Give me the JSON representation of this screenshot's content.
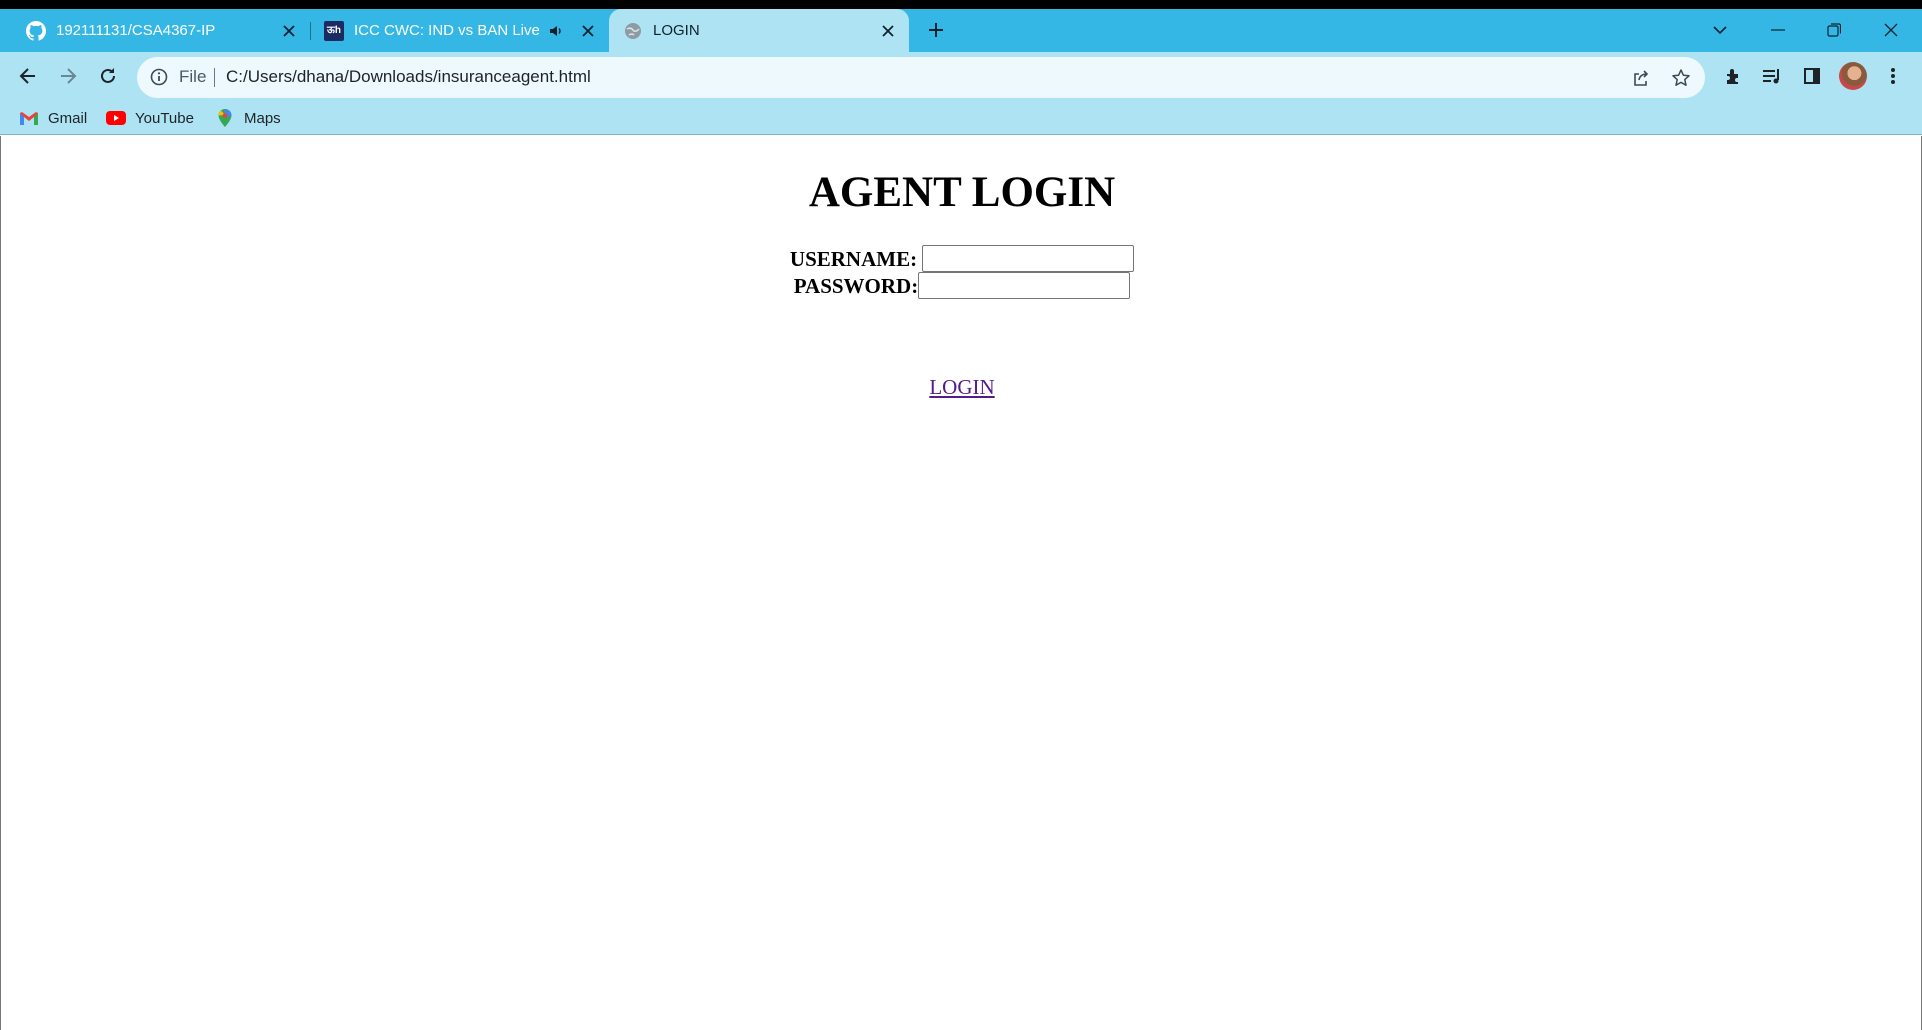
{
  "browser": {
    "tabs": [
      {
        "title": "192111131/CSA4367-IP",
        "icon": "github-icon",
        "active": false
      },
      {
        "title": "ICC CWC: IND vs BAN Live s",
        "icon": "dh-news-icon",
        "audio": true,
        "active": false
      },
      {
        "title": "LOGIN",
        "icon": "globe-icon",
        "active": true
      }
    ],
    "new_tab_label": "+",
    "address": {
      "scheme_label": "File",
      "url": "C:/Users/dhana/Downloads/insuranceagent.html"
    },
    "bookmarks": [
      {
        "label": "Gmail",
        "icon": "gmail-icon"
      },
      {
        "label": "YouTube",
        "icon": "youtube-icon"
      },
      {
        "label": "Maps",
        "icon": "maps-icon"
      }
    ],
    "colors": {
      "tabstrip": "#35b7e6",
      "toolbar": "#aee3f3",
      "omnibox": "#eef9fd"
    }
  },
  "page": {
    "heading": "AGENT LOGIN",
    "username_label": "USERNAME:",
    "password_label": "PASSWORD:",
    "username_value": "",
    "password_value": "",
    "login_link": "LOGIN",
    "link_color": "#551a8b"
  }
}
